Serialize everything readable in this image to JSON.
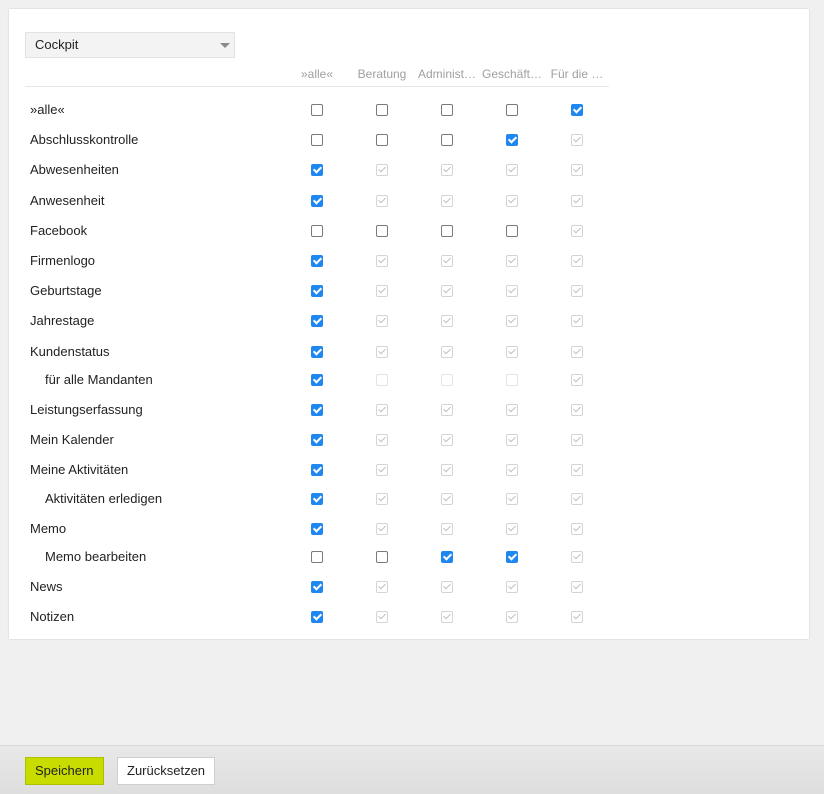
{
  "select": {
    "value": "Cockpit"
  },
  "columns": [
    "»alle«",
    "Beratung",
    "Administ…",
    "Geschäft…",
    "Für die …"
  ],
  "rows": [
    {
      "label": "»alle«",
      "sub": false,
      "states": [
        "off",
        "off",
        "off",
        "off",
        "on"
      ]
    },
    {
      "label": "Abschlusskontrolle",
      "sub": false,
      "states": [
        "off",
        "off",
        "off",
        "on",
        "inh"
      ]
    },
    {
      "label": "Abwesenheiten",
      "sub": false,
      "states": [
        "on",
        "inh",
        "inh",
        "inh",
        "inh"
      ]
    },
    {
      "label": "Anwesenheit",
      "sub": false,
      "states": [
        "on",
        "inh",
        "inh",
        "inh",
        "inh"
      ]
    },
    {
      "label": "Facebook",
      "sub": false,
      "states": [
        "off",
        "off",
        "off",
        "off",
        "inh"
      ]
    },
    {
      "label": "Firmenlogo",
      "sub": false,
      "states": [
        "on",
        "inh",
        "inh",
        "inh",
        "inh"
      ]
    },
    {
      "label": "Geburtstage",
      "sub": false,
      "states": [
        "on",
        "inh",
        "inh",
        "inh",
        "inh"
      ]
    },
    {
      "label": "Jahrestage",
      "sub": false,
      "states": [
        "on",
        "inh",
        "inh",
        "inh",
        "inh"
      ]
    },
    {
      "label": "Kundenstatus",
      "sub": false,
      "states": [
        "on",
        "inh",
        "inh",
        "inh",
        "inh"
      ]
    },
    {
      "label": "für alle Mandanten",
      "sub": true,
      "states": [
        "on",
        "dis",
        "dis",
        "dis",
        "inh"
      ]
    },
    {
      "label": "Leistungserfassung",
      "sub": false,
      "states": [
        "on",
        "inh",
        "inh",
        "inh",
        "inh"
      ]
    },
    {
      "label": "Mein Kalender",
      "sub": false,
      "states": [
        "on",
        "inh",
        "inh",
        "inh",
        "inh"
      ]
    },
    {
      "label": "Meine Aktivitäten",
      "sub": false,
      "states": [
        "on",
        "inh",
        "inh",
        "inh",
        "inh"
      ]
    },
    {
      "label": "Aktivitäten erledigen",
      "sub": true,
      "states": [
        "on",
        "inh",
        "inh",
        "inh",
        "inh"
      ]
    },
    {
      "label": "Memo",
      "sub": false,
      "states": [
        "on",
        "inh",
        "inh",
        "inh",
        "inh"
      ]
    },
    {
      "label": "Memo bearbeiten",
      "sub": true,
      "states": [
        "off",
        "off",
        "on",
        "on",
        "inh"
      ]
    },
    {
      "label": "News",
      "sub": false,
      "states": [
        "on",
        "inh",
        "inh",
        "inh",
        "inh"
      ]
    },
    {
      "label": "Notizen",
      "sub": false,
      "states": [
        "on",
        "inh",
        "inh",
        "inh",
        "inh"
      ]
    }
  ],
  "footer": {
    "save_label": "Speichern",
    "reset_label": "Zurücksetzen"
  },
  "colors": {
    "accent": "#1e88f0",
    "save_button": "#c8dc00"
  }
}
